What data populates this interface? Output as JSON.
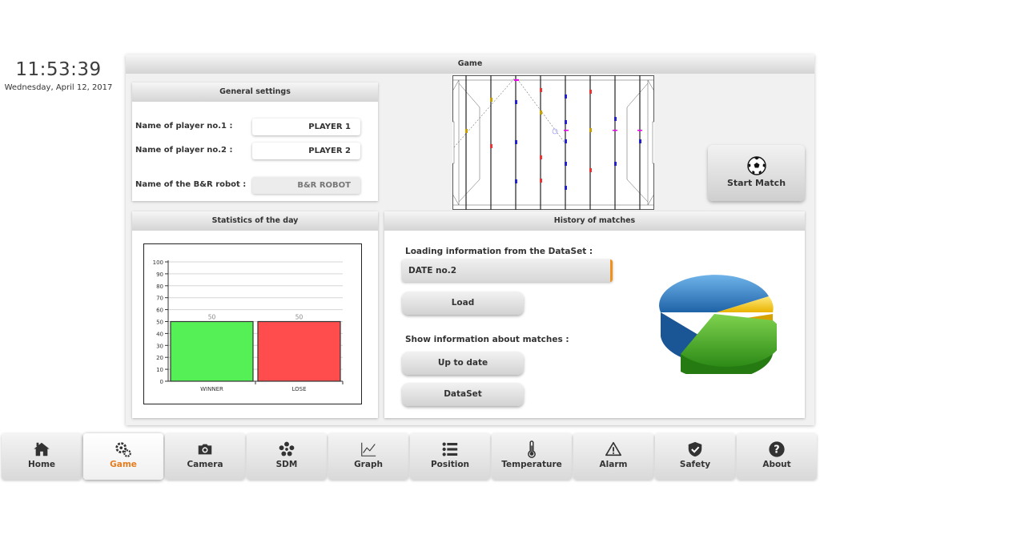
{
  "clock": {
    "time": "11:53:39",
    "date": "Wednesday, April 12, 2017"
  },
  "game_panel": {
    "title": "Game"
  },
  "general_settings": {
    "title": "General settings",
    "player1_label": "Name of player no.1 :",
    "player1_value": "PLAYER 1",
    "player2_label": "Name of player no.2 :",
    "player2_value": "PLAYER 2",
    "robot_label": "Name of the B&R robot :",
    "robot_value": "B&R ROBOT"
  },
  "start_match": {
    "label": "Start Match",
    "icon": "soccer-ball-icon"
  },
  "statistics": {
    "title": "Statistics of the day"
  },
  "chart_data": {
    "type": "bar",
    "categories": [
      "WINNER",
      "LOSE"
    ],
    "values": [
      50,
      50
    ],
    "colors": [
      "#55f055",
      "#ff4d4d"
    ],
    "ylim": [
      0,
      100
    ],
    "yticks": [
      0,
      10,
      20,
      30,
      40,
      50,
      60,
      70,
      80,
      90,
      100
    ],
    "grid": true,
    "data_labels": [
      "50",
      "50"
    ]
  },
  "history": {
    "title": "History of matches",
    "loading_label": "Loading information from the DataSet :",
    "dataset_value": "DATE no.2",
    "load_button": "Load",
    "show_label": "Show information about matches :",
    "uptodate_button": "Up to date",
    "dataset_button": "DataSet",
    "accent_color": "#f0901e"
  },
  "nav": {
    "items": [
      {
        "label": "Home",
        "icon": "home-icon"
      },
      {
        "label": "Game",
        "icon": "gears-icon",
        "active": true
      },
      {
        "label": "Camera",
        "icon": "camera-icon"
      },
      {
        "label": "SDM",
        "icon": "sdm-icon"
      },
      {
        "label": "Graph",
        "icon": "line-graph-icon"
      },
      {
        "label": "Position",
        "icon": "list-icon"
      },
      {
        "label": "Temperature",
        "icon": "thermometer-icon"
      },
      {
        "label": "Alarm",
        "icon": "warning-icon"
      },
      {
        "label": "Safety",
        "icon": "shield-check-icon"
      },
      {
        "label": "About",
        "icon": "help-icon"
      }
    ],
    "active_color": "#e57c1f"
  }
}
